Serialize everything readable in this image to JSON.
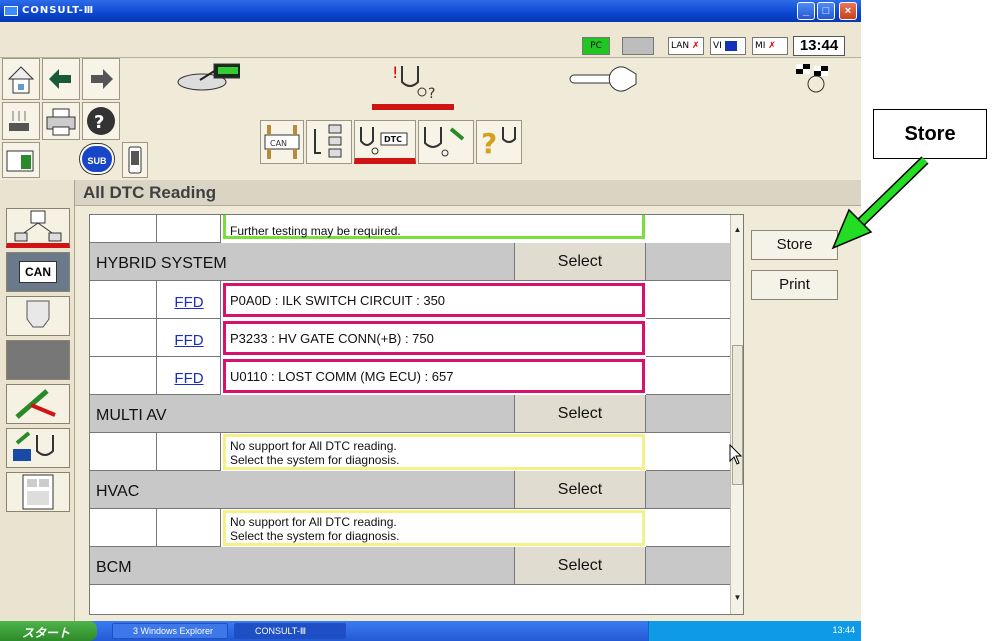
{
  "window": {
    "title": "CONSULT-Ⅲ"
  },
  "status": {
    "indicators": [
      "PC",
      "LAN",
      "VI",
      "MI"
    ],
    "clock": "13:44"
  },
  "header": {
    "title": "All DTC Reading"
  },
  "list": {
    "top_partial_text": "Further testing may be required.",
    "rows": [
      {
        "kind": "system",
        "name": "HYBRID SYSTEM",
        "select": "Select"
      },
      {
        "kind": "dtc",
        "ffd": "FFD",
        "text": "P0A0D : ILK SWITCH CIRCUIT   : 350"
      },
      {
        "kind": "dtc",
        "ffd": "FFD",
        "text": "P3233 : HV GATE CONN(+B)   : 750"
      },
      {
        "kind": "dtc",
        "ffd": "FFD",
        "text": "U0110 : LOST COMM (MG ECU)   : 657"
      },
      {
        "kind": "system",
        "name": "MULTI AV",
        "select": "Select"
      },
      {
        "kind": "msg",
        "line1": "No support for All DTC reading.",
        "line2": "Select the system for diagnosis."
      },
      {
        "kind": "system",
        "name": "HVAC",
        "select": "Select"
      },
      {
        "kind": "msg",
        "line1": "No support for All DTC reading.",
        "line2": "Select the system for diagnosis."
      },
      {
        "kind": "system",
        "name": "BCM",
        "select": "Select"
      }
    ]
  },
  "side_buttons": {
    "store": "Store",
    "print": "Print"
  },
  "toolbar": {
    "sub_label": "SUB",
    "can_label": "CAN",
    "dtc_label": "DTC"
  },
  "taskbar": {
    "start": "スタート",
    "items": [
      "3 Windows Explorer",
      "CONSULT-Ⅲ"
    ],
    "tray_time": "13:44"
  },
  "callout": {
    "label": "Store"
  },
  "colors": {
    "dtc_border": "#d8126c",
    "msg_border": "#f6f08a",
    "green_border": "#7adf3c",
    "arrow": "#22dd22",
    "titlebar": "#0a46d1"
  }
}
